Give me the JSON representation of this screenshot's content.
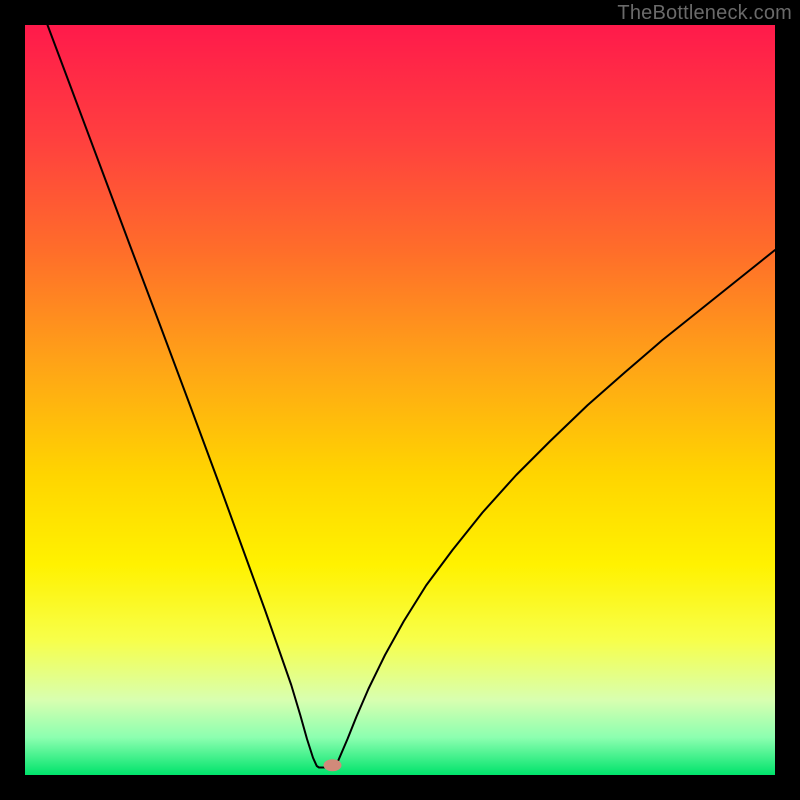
{
  "watermark": "TheBottleneck.com",
  "chart_data": {
    "type": "line",
    "title": "",
    "xlabel": "",
    "ylabel": "",
    "xlim": [
      0,
      100
    ],
    "ylim": [
      0,
      100
    ],
    "background_gradient": {
      "type": "vertical",
      "stops": [
        {
          "pos": 0.0,
          "color": "#ff1a4b"
        },
        {
          "pos": 0.15,
          "color": "#ff3f3f"
        },
        {
          "pos": 0.3,
          "color": "#ff6d2a"
        },
        {
          "pos": 0.45,
          "color": "#ffa317"
        },
        {
          "pos": 0.6,
          "color": "#ffd500"
        },
        {
          "pos": 0.72,
          "color": "#fff200"
        },
        {
          "pos": 0.82,
          "color": "#f7ff4a"
        },
        {
          "pos": 0.9,
          "color": "#d8ffb0"
        },
        {
          "pos": 0.95,
          "color": "#8cffb0"
        },
        {
          "pos": 1.0,
          "color": "#00e36b"
        }
      ]
    },
    "series": [
      {
        "name": "bottleneck-curve",
        "stroke": "#000000",
        "stroke_width": 2,
        "points": [
          {
            "x": 3.0,
            "y": 100.0
          },
          {
            "x": 6.0,
            "y": 92.0
          },
          {
            "x": 10.0,
            "y": 81.3
          },
          {
            "x": 14.0,
            "y": 70.6
          },
          {
            "x": 18.0,
            "y": 60.0
          },
          {
            "x": 22.0,
            "y": 49.3
          },
          {
            "x": 26.0,
            "y": 38.5
          },
          {
            "x": 30.0,
            "y": 27.5
          },
          {
            "x": 32.0,
            "y": 22.0
          },
          {
            "x": 34.0,
            "y": 16.3
          },
          {
            "x": 35.5,
            "y": 12.0
          },
          {
            "x": 36.7,
            "y": 8.0
          },
          {
            "x": 37.6,
            "y": 4.8
          },
          {
            "x": 38.4,
            "y": 2.3
          },
          {
            "x": 38.9,
            "y": 1.2
          },
          {
            "x": 39.2,
            "y": 1.0
          },
          {
            "x": 40.5,
            "y": 1.0
          },
          {
            "x": 41.2,
            "y": 1.0
          },
          {
            "x": 41.8,
            "y": 2.0
          },
          {
            "x": 43.0,
            "y": 4.8
          },
          {
            "x": 44.2,
            "y": 7.8
          },
          {
            "x": 45.8,
            "y": 11.5
          },
          {
            "x": 48.0,
            "y": 16.0
          },
          {
            "x": 50.5,
            "y": 20.5
          },
          {
            "x": 53.5,
            "y": 25.3
          },
          {
            "x": 57.0,
            "y": 30.0
          },
          {
            "x": 61.0,
            "y": 35.0
          },
          {
            "x": 65.5,
            "y": 40.0
          },
          {
            "x": 70.0,
            "y": 44.5
          },
          {
            "x": 75.0,
            "y": 49.3
          },
          {
            "x": 80.0,
            "y": 53.7
          },
          {
            "x": 85.0,
            "y": 58.0
          },
          {
            "x": 90.0,
            "y": 62.0
          },
          {
            "x": 95.0,
            "y": 66.0
          },
          {
            "x": 100.0,
            "y": 70.0
          }
        ]
      }
    ],
    "marker": {
      "name": "target-point",
      "x": 41.0,
      "y": 1.3,
      "rx": 1.2,
      "ry": 0.8,
      "fill": "#d18a7a"
    }
  }
}
